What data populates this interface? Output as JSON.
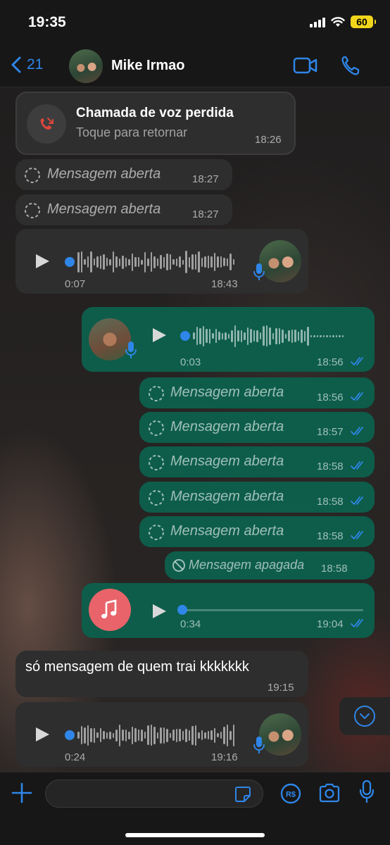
{
  "status": {
    "time": "19:35",
    "battery": "60"
  },
  "nav": {
    "back_count": "21",
    "contact_name": "Mike Irmao"
  },
  "missed_call": {
    "title": "Chamada de voz perdida",
    "subtitle": "Toque para retornar",
    "time": "18:26"
  },
  "incoming_opened": [
    {
      "text": "Mensagem aberta",
      "time": "18:27"
    },
    {
      "text": "Mensagem aberta",
      "time": "18:27"
    }
  ],
  "voice_in_1": {
    "duration": "0:07",
    "time": "18:43"
  },
  "voice_out_1": {
    "duration": "0:03",
    "time": "18:56"
  },
  "outgoing_opened": [
    {
      "text": "Mensagem aberta",
      "time": "18:56"
    },
    {
      "text": "Mensagem aberta",
      "time": "18:57"
    },
    {
      "text": "Mensagem aberta",
      "time": "18:58"
    },
    {
      "text": "Mensagem aberta",
      "time": "18:58"
    },
    {
      "text": "Mensagem aberta",
      "time": "18:58"
    }
  ],
  "deleted": {
    "text": "Mensagem apagada",
    "time": "18:58"
  },
  "audio_out": {
    "duration": "0:34",
    "time": "19:04"
  },
  "text_in": {
    "text": "só mensagem de quem trai kkkkkkk",
    "time": "19:15"
  },
  "voice_in_2": {
    "duration": "0:24",
    "time": "19:16"
  },
  "colors": {
    "accent": "#2f86e8",
    "outgoing": "#0d5d4a",
    "incoming": "#2e2e2f",
    "missed": "#e0463c",
    "battery": "#f2d61b",
    "music": "#e8646a"
  },
  "icons": [
    "back-chevron-icon",
    "video-call-icon",
    "phone-icon",
    "missed-call-icon",
    "view-once-icon",
    "play-icon",
    "mic-icon",
    "read-ticks-icon",
    "blocked-icon",
    "music-note-icon",
    "chevron-down-icon",
    "plus-icon",
    "sticker-icon",
    "pix-icon",
    "camera-icon"
  ]
}
